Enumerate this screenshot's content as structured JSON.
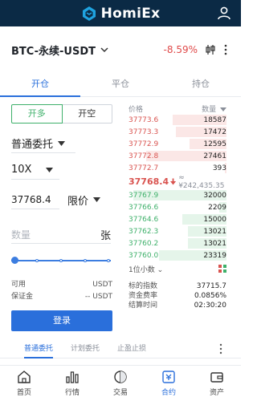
{
  "app": {
    "brand": "HomiEx"
  },
  "market": {
    "pair": "BTC-永续-USDT",
    "change": "-8.59%"
  },
  "tabs": [
    {
      "label": "开仓"
    },
    {
      "label": "平仓"
    },
    {
      "label": "持仓"
    }
  ],
  "order": {
    "buy_label": "开多",
    "sell_label": "开空",
    "order_type": "普通委托",
    "leverage": "10X",
    "price_value": "37768.4",
    "price_type": "限价",
    "qty_placeholder": "数量",
    "qty_unit": "张",
    "slider_level": 0,
    "available_label": "可用",
    "available_value": "USDT",
    "margin_label": "保证金",
    "margin_value": "-- USDT",
    "login_label": "登录"
  },
  "orderbook": {
    "price_header": "价格",
    "qty_header": "数量",
    "asks": [
      {
        "price": "37773.6",
        "qty": "18587",
        "depth": 0.55
      },
      {
        "price": "37773.3",
        "qty": "17472",
        "depth": 0.52
      },
      {
        "price": "37772.9",
        "qty": "12595",
        "depth": 0.38
      },
      {
        "price": "37772.8",
        "qty": "27461",
        "depth": 0.82
      },
      {
        "price": "37772.7",
        "qty": "393",
        "depth": 0.02
      }
    ],
    "last_price": "37768.4",
    "last_price_cny": "≈ ¥242,435.35",
    "bids": [
      {
        "price": "37767.9",
        "qty": "32000",
        "depth": 0.95
      },
      {
        "price": "37766.6",
        "qty": "2209",
        "depth": 0.07
      },
      {
        "price": "37764.6",
        "qty": "15000",
        "depth": 0.45
      },
      {
        "price": "37762.3",
        "qty": "13021",
        "depth": 0.39
      },
      {
        "price": "37760.2",
        "qty": "13021",
        "depth": 0.39
      },
      {
        "price": "37760.0",
        "qty": "23319",
        "depth": 0.69
      }
    ],
    "precision": "1位小数",
    "stats": [
      {
        "label": "标的指数",
        "value": "37715.7"
      },
      {
        "label": "资金费率",
        "value": "0.0856%"
      },
      {
        "label": "结算时间",
        "value": "02:30:20"
      }
    ]
  },
  "order_tabs": [
    {
      "label": "普通委托"
    },
    {
      "label": "计划委托"
    },
    {
      "label": "止盈止损"
    }
  ],
  "bottom_nav": [
    {
      "label": "首页",
      "icon": "home-icon"
    },
    {
      "label": "行情",
      "icon": "chart-icon"
    },
    {
      "label": "交易",
      "icon": "trade-icon"
    },
    {
      "label": "合约",
      "icon": "contract-icon"
    },
    {
      "label": "资产",
      "icon": "wallet-icon"
    }
  ],
  "colors": {
    "accent": "#2a6fdb",
    "header_bg": "#0b2a45",
    "ask": "#d9534f",
    "bid": "#3eb06a"
  }
}
